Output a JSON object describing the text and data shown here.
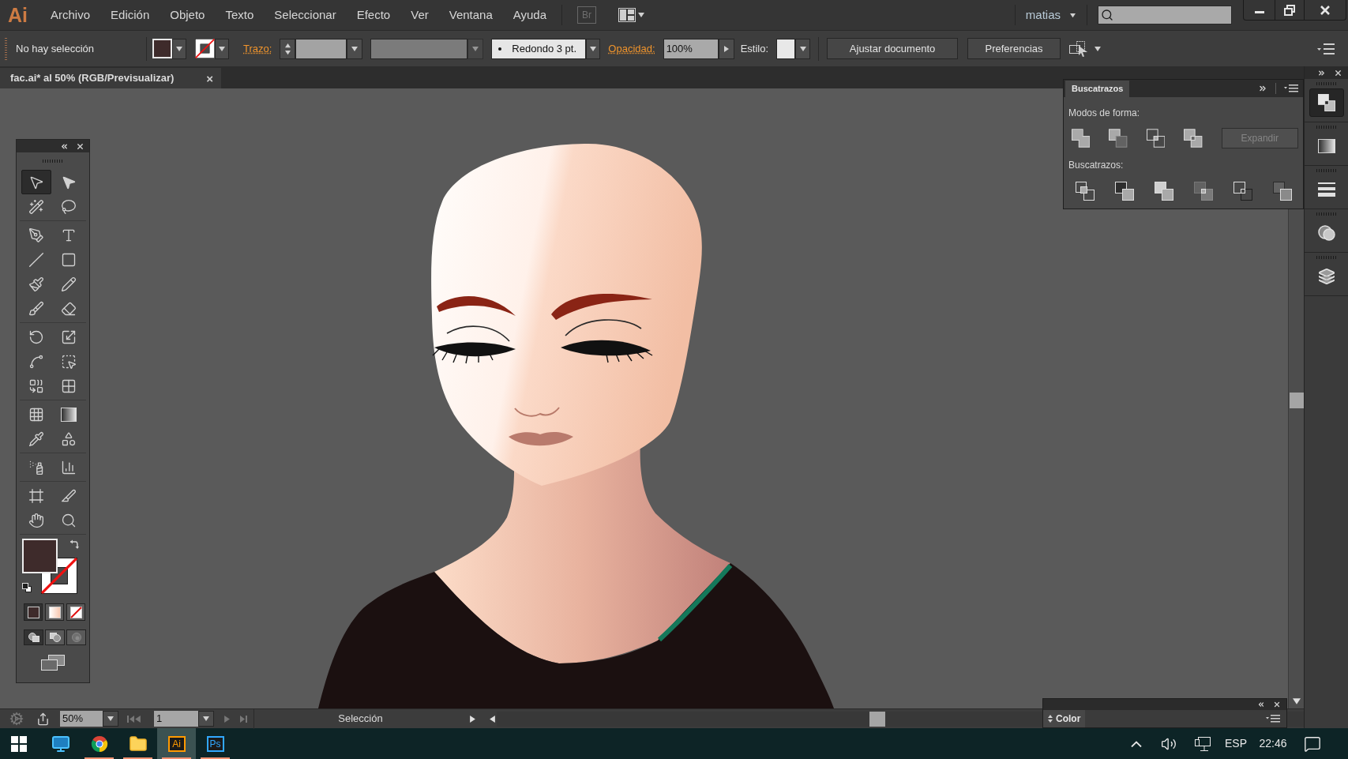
{
  "menu_bar": {
    "logo": "Ai",
    "menus": [
      "Archivo",
      "Edición",
      "Objeto",
      "Texto",
      "Seleccionar",
      "Efecto",
      "Ver",
      "Ventana",
      "Ayuda"
    ],
    "bridge_button": "Br",
    "user": "matias"
  },
  "control_bar": {
    "selection_status": "No hay selección",
    "fill": {
      "color": "#3e2b2b"
    },
    "stroke": {
      "none": true
    },
    "stroke_link": "Trazo:",
    "brush": "Redondo 3 pt.",
    "opacity_link": "Opacidad:",
    "opacity": "100%",
    "style_label": "Estilo:",
    "buttons": [
      "Ajustar documento",
      "Preferencias"
    ]
  },
  "document_tab": {
    "title": "fac.ai* al 50% (RGB/Previsualizar)",
    "close": "×"
  },
  "toolbox": {
    "tools": [
      {
        "kind": "select",
        "selected": true
      },
      {
        "kind": "direct",
        "selected": false
      },
      {
        "kind": "wand",
        "selected": false
      },
      {
        "kind": "lasso",
        "selected": false
      },
      {
        "kind": "pen",
        "selected": false
      },
      {
        "kind": "type",
        "selected": false
      },
      {
        "kind": "line",
        "selected": false
      },
      {
        "kind": "rectangle",
        "selected": false
      },
      {
        "kind": "paintbrush",
        "selected": false
      },
      {
        "kind": "pencil",
        "selected": false
      },
      {
        "kind": "blob",
        "selected": false
      },
      {
        "kind": "eraser",
        "selected": false
      },
      {
        "kind": "rotate",
        "selected": false
      },
      {
        "kind": "scale",
        "selected": false
      },
      {
        "kind": "warp",
        "selected": false
      },
      {
        "kind": "transform",
        "selected": false
      },
      {
        "kind": "builder",
        "selected": false
      },
      {
        "kind": "perspective",
        "selected": false
      },
      {
        "kind": "mesh",
        "selected": false
      },
      {
        "kind": "gradient",
        "selected": false
      },
      {
        "kind": "eyedropper",
        "selected": false
      },
      {
        "kind": "blend",
        "selected": false
      },
      {
        "kind": "sprayer",
        "selected": false
      },
      {
        "kind": "graph",
        "selected": false
      },
      {
        "kind": "artboard",
        "selected": false
      },
      {
        "kind": "slice",
        "selected": false
      },
      {
        "kind": "hand",
        "selected": false
      },
      {
        "kind": "zoom",
        "selected": false
      }
    ],
    "fill": {
      "color": "#3e2b2b"
    },
    "stroke": {
      "none": true
    }
  },
  "pathfinder_panel": {
    "title": "Buscatrazos",
    "shape_modes_label": "Modos de forma:",
    "expand_button": {
      "label": "Expandir",
      "disabled": true
    },
    "pathfinders_label": "Buscatrazos:"
  },
  "dock": {
    "buttons": [
      {
        "kind": "pathfinder",
        "selected": true
      },
      {
        "kind": "gradient",
        "selected": false
      },
      {
        "kind": "stroke",
        "selected": false
      },
      {
        "kind": "transparency",
        "selected": false
      },
      {
        "kind": "layers",
        "selected": false
      }
    ]
  },
  "status_bar": {
    "zoom": "50%",
    "artboard": "1",
    "current_tool": "Selección"
  },
  "color_panel": {
    "title": "Color"
  },
  "taskbar": {
    "apps": [
      {
        "kind": "monitor",
        "running": false,
        "selected": false
      },
      {
        "kind": "browser",
        "running": true,
        "selected": false
      },
      {
        "kind": "folder",
        "running": true,
        "selected": false
      },
      {
        "kind": "tile",
        "label": "Ai",
        "color": "#ff9a00",
        "running": true,
        "selected": true
      },
      {
        "kind": "tile",
        "label": "Ps",
        "color": "#31a8ff",
        "running": true,
        "selected": false
      }
    ],
    "language": "ESP",
    "time": "22:46"
  }
}
